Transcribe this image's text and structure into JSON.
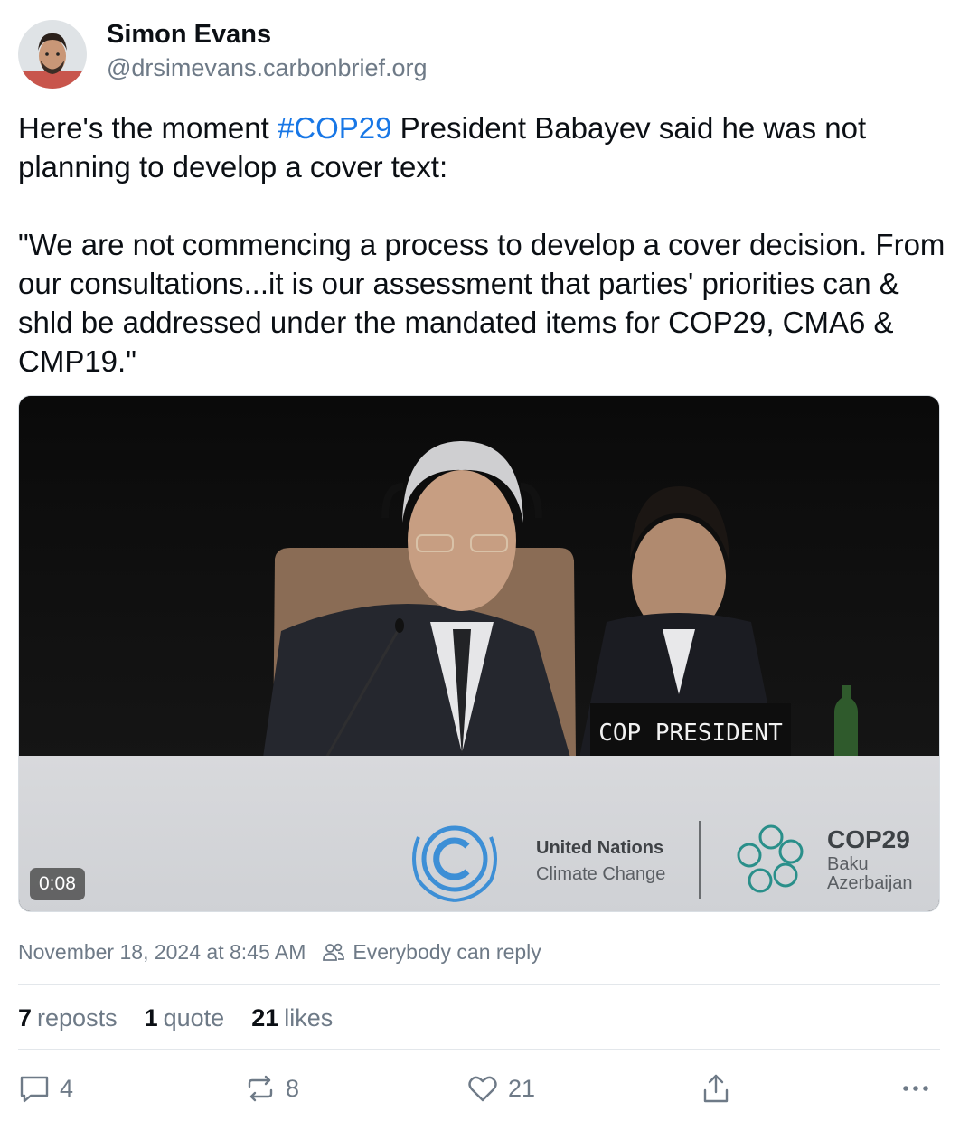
{
  "author": {
    "display_name": "Simon Evans",
    "handle": "@drsimevans.carbonbrief.org"
  },
  "post": {
    "text_before_tag": "Here's the moment ",
    "hashtag": "#COP29",
    "text_after_tag": " President Babayev said he was not planning to develop a cover text:\n\n\"We are not commencing a process to develop a cover decision. From our consultations...it is our assessment that parties' priorities can & shld be addressed under the mandated items for COP29, CMA6 & CMP19.\""
  },
  "video": {
    "duration": "0:08",
    "nameplate": "COP PRESIDENT",
    "un_line1": "United Nations",
    "un_line2": "Climate Change",
    "cop_title": "COP29",
    "cop_city": "Baku",
    "cop_country": "Azerbaijan"
  },
  "meta": {
    "timestamp": "November 18, 2024 at 8:45 AM",
    "reply_setting": "Everybody can reply"
  },
  "stats": {
    "reposts_count": "7",
    "reposts_label": "reposts",
    "quotes_count": "1",
    "quotes_label": "quote",
    "likes_count": "21",
    "likes_label": "likes"
  },
  "actions": {
    "reply_count": "4",
    "repost_count": "8",
    "like_count": "21"
  },
  "icons": [
    "reply-icon",
    "repost-icon",
    "like-icon",
    "share-icon",
    "more-icon",
    "people-icon"
  ],
  "colors": {
    "accent": "#1877e6",
    "muted": "#6e7a87",
    "text": "#0b0f14"
  }
}
